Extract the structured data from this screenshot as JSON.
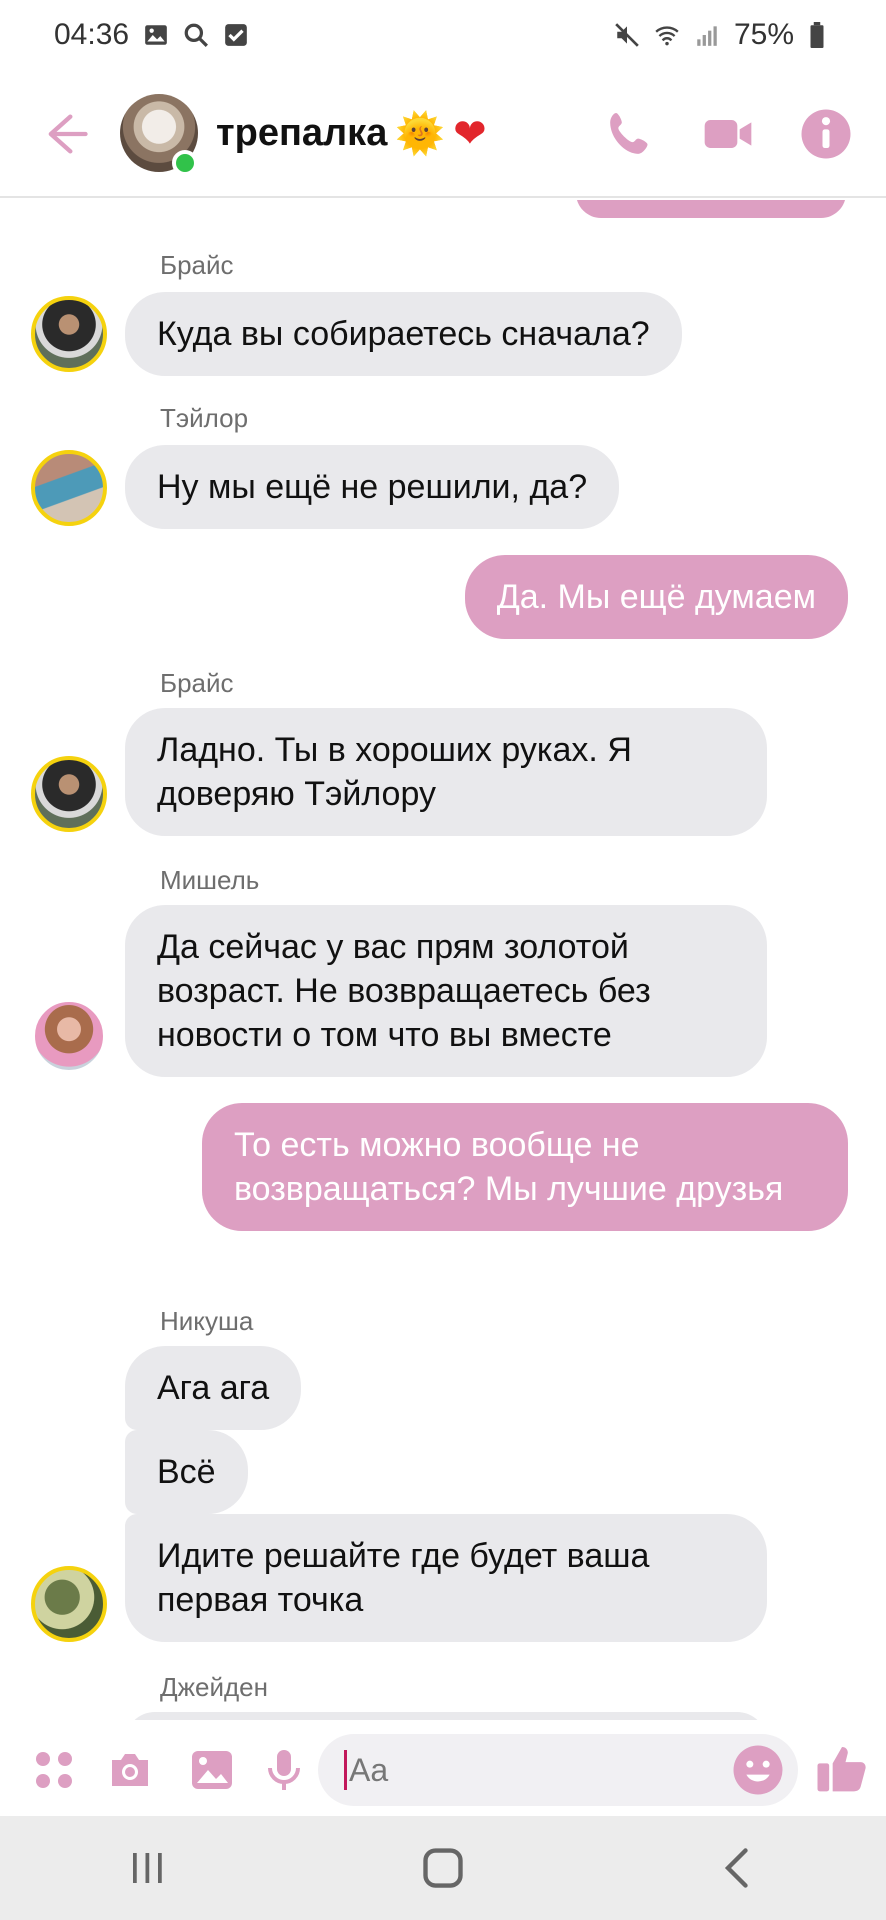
{
  "status_bar": {
    "time": "04:36",
    "battery": "75%"
  },
  "header": {
    "title": "трепалка",
    "title_emojis": [
      "🌞",
      "❤"
    ]
  },
  "messages": [
    {
      "sender": "Брайс",
      "text": "Куда вы собираетесь сначала?"
    },
    {
      "sender": "Тэйлор",
      "text": "Ну мы ещё не решили, да?"
    },
    {
      "sender": "me",
      "text": "Да. Мы ещё  думаем"
    },
    {
      "sender": "Брайс",
      "text": "Ладно. Ты в хороших руках. Я доверяю Тэйлору"
    },
    {
      "sender": "Мишель",
      "text": "Да сейчас у вас прям золотой возраст. Не возвращаетесь без новости о том что вы вместе"
    },
    {
      "sender": "me",
      "text": "То есть можно вообще не возвращаться? Мы лучшие друзья"
    },
    {
      "sender": "Никуша",
      "text": "Ага ага"
    },
    {
      "sender": "Никуша",
      "text": "Всё"
    },
    {
      "sender": "Никуша",
      "text": "Идите решайте где будет ваша первая точка"
    },
    {
      "sender": "Джейден",
      "text": ""
    }
  ],
  "names": {
    "bryce": "Брайс",
    "taylor": "Тэйлор",
    "michelle": "Мишель",
    "nikusha": "Никуша",
    "jayden": "Джейден"
  },
  "composer": {
    "placeholder": "Aa"
  },
  "colors": {
    "accent": "#dd9fc2",
    "incoming_bubble": "#e9e9ec",
    "online": "#31c24a"
  }
}
